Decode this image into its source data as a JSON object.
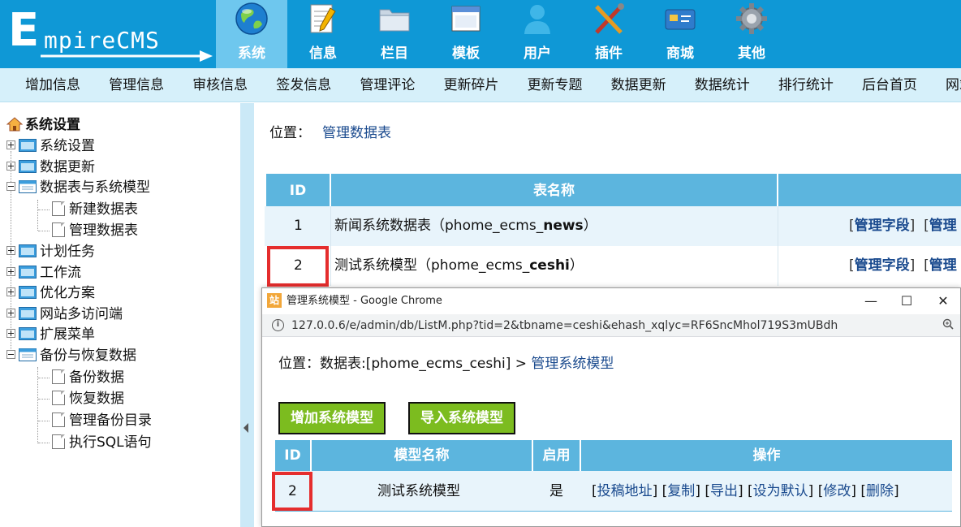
{
  "logo": {
    "big_letter": "E",
    "rest": "mpireCMS"
  },
  "nav_tabs": [
    {
      "label": "系统",
      "icon": "globe-icon",
      "active": true
    },
    {
      "label": "信息",
      "icon": "notepad-icon"
    },
    {
      "label": "栏目",
      "icon": "folder-icon"
    },
    {
      "label": "模板",
      "icon": "window-icon"
    },
    {
      "label": "用户",
      "icon": "user-icon"
    },
    {
      "label": "插件",
      "icon": "tools-icon"
    },
    {
      "label": "商城",
      "icon": "card-icon"
    },
    {
      "label": "其他",
      "icon": "gear-icon"
    }
  ],
  "submenu": [
    "增加信息",
    "管理信息",
    "审核信息",
    "签发信息",
    "管理评论",
    "更新碎片",
    "更新专题",
    "数据更新",
    "数据统计",
    "排行统计",
    "后台首页",
    "网站首页"
  ],
  "tree": {
    "root": "系统设置",
    "nodes": [
      {
        "label": "系统设置",
        "expanded": false
      },
      {
        "label": "数据更新",
        "expanded": false
      },
      {
        "label": "数据表与系统模型",
        "expanded": true,
        "children": [
          "新建数据表",
          "管理数据表"
        ]
      },
      {
        "label": "计划任务",
        "expanded": false
      },
      {
        "label": "工作流",
        "expanded": false
      },
      {
        "label": "优化方案",
        "expanded": false
      },
      {
        "label": "网站多访问端",
        "expanded": false
      },
      {
        "label": "扩展菜单",
        "expanded": false
      },
      {
        "label": "备份与恢复数据",
        "expanded": true,
        "children": [
          "备份数据",
          "恢复数据",
          "管理备份目录",
          "执行SQL语句"
        ]
      }
    ]
  },
  "main": {
    "location_label": "位置：",
    "location_link": "管理数据表",
    "headers": [
      "ID",
      "表名称",
      ""
    ],
    "rows": [
      {
        "id": "1",
        "name_prefix": "新闻系统数据表（phome_ecms_",
        "name_bold": "news",
        "name_suffix": "）",
        "action1": "管理字段",
        "action2": "管理"
      },
      {
        "id": "2",
        "name_prefix": "测试系统模型（phome_ecms_",
        "name_bold": "ceshi",
        "name_suffix": "）",
        "action1": "管理字段",
        "action2": "管理"
      }
    ]
  },
  "popup": {
    "window_title": "管理系统模型 - Google Chrome",
    "site_icon_text": "站",
    "url": "127.0.0.6/e/admin/db/ListM.php?tid=2&tbname=ceshi&ehash_xqlyc=RF6SncMhol719S3mUBdh",
    "location_prefix": "位置：数据表:[phome_ecms_ceshi] > ",
    "location_link": "管理系统模型",
    "buttons": [
      "增加系统模型",
      "导入系统模型"
    ],
    "headers": [
      "ID",
      "模型名称",
      "启用",
      "操作"
    ],
    "row": {
      "id": "2",
      "name": "测试系统模型",
      "enabled": "是",
      "actions": [
        "投稿地址",
        "复制",
        "导出",
        "设为默认",
        "修改",
        "删除"
      ]
    }
  },
  "colors": {
    "header_blue": "#0f98d6",
    "active_tab": "#6ec7ee",
    "table_head": "#5cb5de",
    "green_button": "#7cbc1f",
    "highlight_red": "#e52d2d"
  }
}
